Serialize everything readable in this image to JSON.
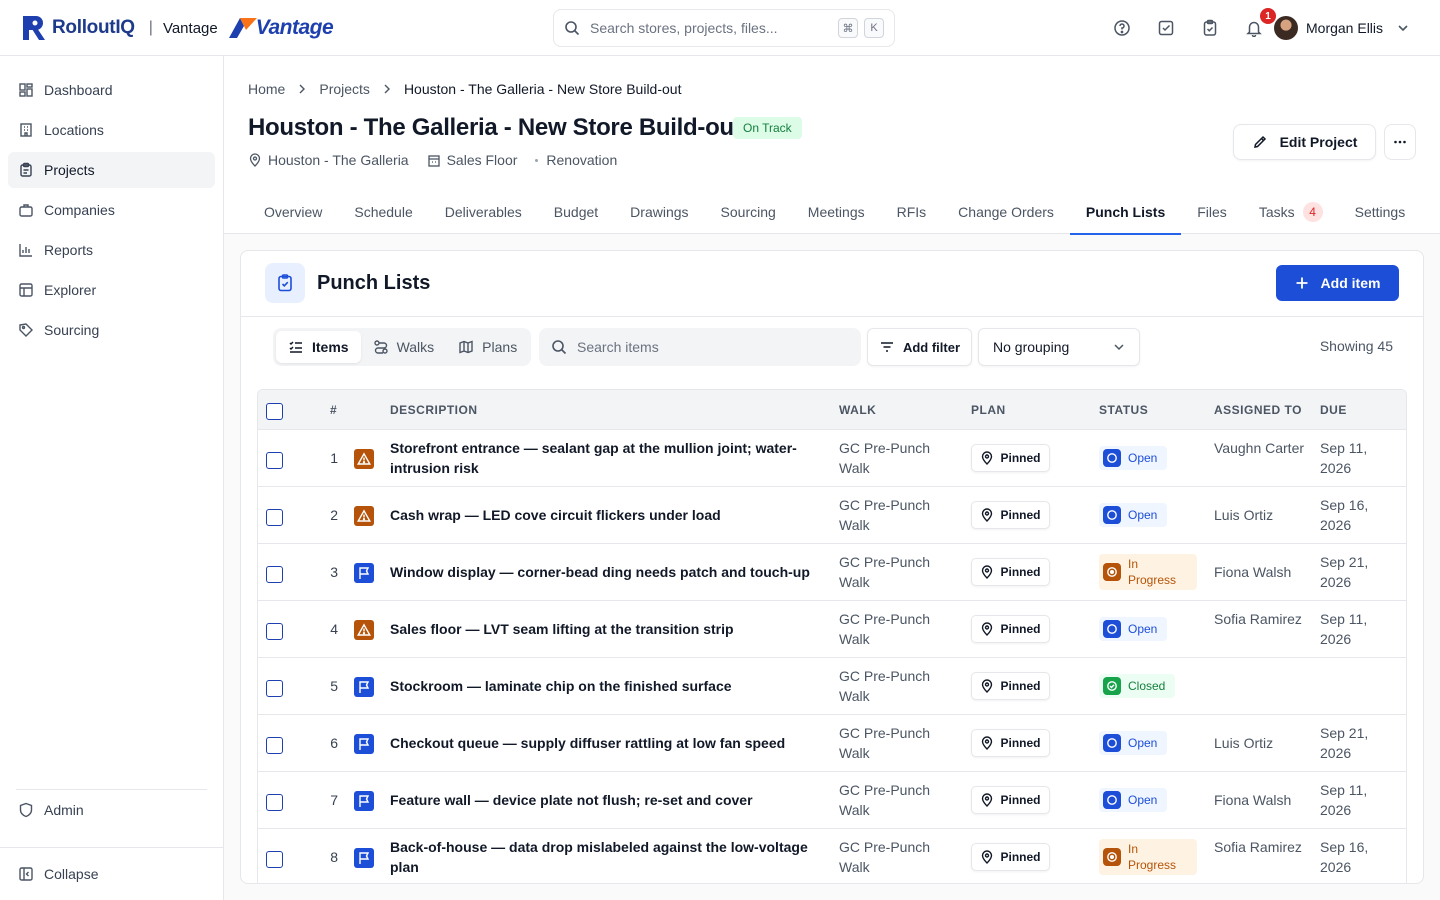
{
  "app": {
    "brand_name": "RolloutIQ",
    "tenant_label": "Vantage",
    "tenant_logo_text": "Vantage"
  },
  "search": {
    "placeholder": "Search stores, projects, files...",
    "kbd_1": "⌘",
    "kbd_2": "K"
  },
  "notifications": {
    "count": "1"
  },
  "user": {
    "name": "Morgan Ellis"
  },
  "sidebar": {
    "items": [
      {
        "label": "Dashboard",
        "icon": "dashboard-icon"
      },
      {
        "label": "Locations",
        "icon": "building-icon"
      },
      {
        "label": "Projects",
        "icon": "clipboard-icon",
        "active": true
      },
      {
        "label": "Companies",
        "icon": "briefcase-icon"
      },
      {
        "label": "Reports",
        "icon": "bar-chart-icon"
      },
      {
        "label": "Explorer",
        "icon": "table-icon"
      },
      {
        "label": "Sourcing",
        "icon": "tag-icon"
      }
    ],
    "admin_label": "Admin",
    "collapse_label": "Collapse"
  },
  "breadcrumb": {
    "home": "Home",
    "projects": "Projects",
    "current": "Houston - The Galleria - New Store Build-out"
  },
  "project": {
    "title": "Houston - The Galleria - New Store Build-out",
    "status": "On Track",
    "location": "Houston - The Galleria",
    "area": "Sales Floor",
    "type": "Renovation",
    "edit_label": "Edit Project"
  },
  "tabs": [
    {
      "label": "Overview"
    },
    {
      "label": "Schedule"
    },
    {
      "label": "Deliverables"
    },
    {
      "label": "Budget"
    },
    {
      "label": "Drawings"
    },
    {
      "label": "Sourcing"
    },
    {
      "label": "Meetings"
    },
    {
      "label": "RFIs"
    },
    {
      "label": "Change Orders"
    },
    {
      "label": "Punch Lists",
      "active": true
    },
    {
      "label": "Files"
    },
    {
      "label": "Tasks",
      "count": "4"
    },
    {
      "label": "Settings"
    }
  ],
  "punch": {
    "title": "Punch Lists",
    "add_label": "Add item",
    "views": {
      "items": "Items",
      "walks": "Walks",
      "plans": "Plans"
    },
    "search_placeholder": "Search items",
    "filter_label": "Add filter",
    "grouping": "No grouping",
    "showing": "Showing 45"
  },
  "table": {
    "headers": {
      "num": "#",
      "description": "DESCRIPTION",
      "walk": "WALK",
      "plan": "PLAN",
      "status": "STATUS",
      "assigned": "ASSIGNED TO",
      "due": "DUE"
    },
    "rows": [
      {
        "num": "1",
        "type": "warning",
        "description": "Storefront entrance — sealant gap at the mullion joint; water-intrusion risk",
        "walk": "GC Pre-Punch Walk",
        "plan": "Pinned",
        "status": "Open",
        "status_kind": "open",
        "assigned": "Vaughn Carter",
        "due": "Sep 11, 2026"
      },
      {
        "num": "2",
        "type": "warning",
        "description": "Cash wrap — LED cove circuit flickers under load",
        "walk": "GC Pre-Punch Walk",
        "plan": "Pinned",
        "status": "Open",
        "status_kind": "open",
        "assigned": "Luis Ortiz",
        "due": "Sep 16, 2026"
      },
      {
        "num": "3",
        "type": "flag",
        "description": "Window display — corner-bead ding needs patch and touch-up",
        "walk": "GC Pre-Punch Walk",
        "plan": "Pinned",
        "status": "In Progress",
        "status_kind": "progress",
        "assigned": "Fiona Walsh",
        "due": "Sep 21, 2026"
      },
      {
        "num": "4",
        "type": "warning",
        "description": "Sales floor — LVT seam lifting at the transition strip",
        "walk": "GC Pre-Punch Walk",
        "plan": "Pinned",
        "status": "Open",
        "status_kind": "open",
        "assigned": "Sofia Ramirez",
        "due": "Sep 11, 2026"
      },
      {
        "num": "5",
        "type": "flag",
        "description": "Stockroom — laminate chip on the finished surface",
        "walk": "GC Pre-Punch Walk",
        "plan": "Pinned",
        "status": "Closed",
        "status_kind": "closed",
        "assigned": "",
        "due": ""
      },
      {
        "num": "6",
        "type": "flag",
        "description": "Checkout queue — supply diffuser rattling at low fan speed",
        "walk": "GC Pre-Punch Walk",
        "plan": "Pinned",
        "status": "Open",
        "status_kind": "open",
        "assigned": "Luis Ortiz",
        "due": "Sep 21, 2026"
      },
      {
        "num": "7",
        "type": "flag",
        "description": "Feature wall — device plate not flush; re-set and cover",
        "walk": "GC Pre-Punch Walk",
        "plan": "Pinned",
        "status": "Open",
        "status_kind": "open",
        "assigned": "Fiona Walsh",
        "due": "Sep 11, 2026"
      },
      {
        "num": "8",
        "type": "flag",
        "description": "Back-of-house — data drop mislabeled against the low-voltage plan",
        "walk": "GC Pre-Punch Walk",
        "plan": "Pinned",
        "status": "In Progress",
        "status_kind": "progress",
        "assigned": "Sofia Ramirez",
        "due": "Sep 16, 2026"
      }
    ]
  },
  "colors": {
    "accent": "#1d4ed8",
    "success": "#15803d",
    "warning": "#b45309",
    "danger": "#dc2626"
  }
}
